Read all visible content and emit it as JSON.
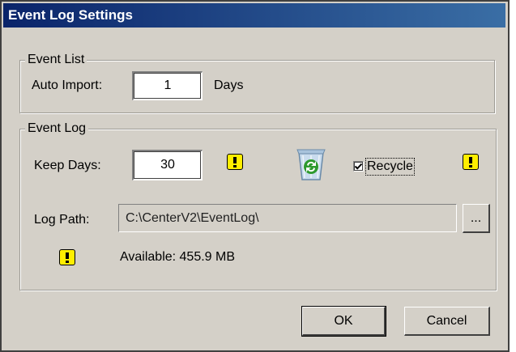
{
  "window": {
    "title": "Event Log Settings"
  },
  "event_list": {
    "legend": "Event List",
    "auto_import_label": "Auto Import:",
    "auto_import_value": "1",
    "days_label": "Days"
  },
  "event_log": {
    "legend": "Event Log",
    "keep_days_label": "Keep Days:",
    "keep_days_value": "30",
    "recycle_label": "Recycle",
    "recycle_checked": true,
    "log_path_label": "Log Path:",
    "log_path_value": "C:\\CenterV2\\EventLog\\",
    "browse_label": "...",
    "available_text": "Available: 455.9 MB"
  },
  "buttons": {
    "ok": "OK",
    "cancel": "Cancel"
  },
  "icons": {
    "warning": "warning-icon",
    "recycle_bin": "recycle-bin-icon",
    "check": "checkmark-icon"
  },
  "colors": {
    "dialog_bg": "#d4d0c8",
    "titlebar_start": "#0a246a",
    "titlebar_end": "#3a6ea5",
    "warning_yellow": "#ffee00"
  }
}
